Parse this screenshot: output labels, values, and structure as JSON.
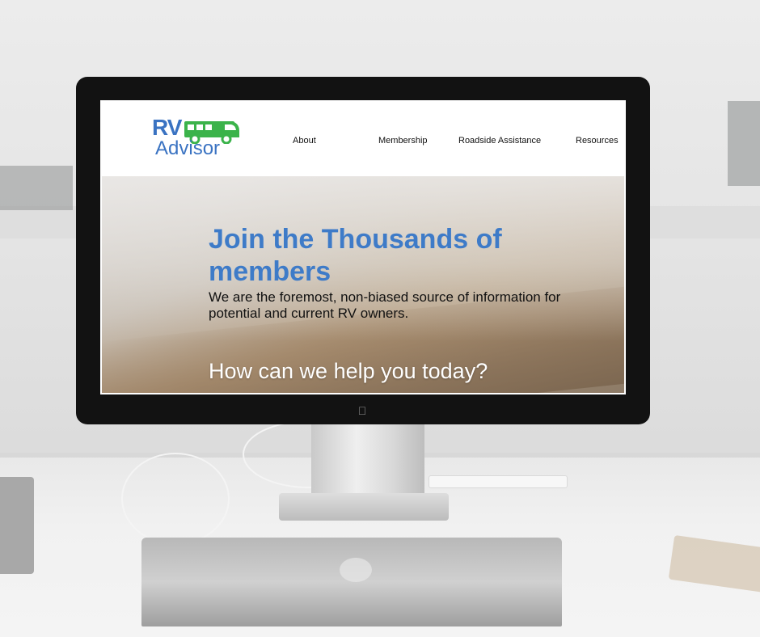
{
  "site": {
    "logo": {
      "line1": "RV",
      "line2": "Advisor",
      "brand_blue": "#3a73c2",
      "brand_green": "#3bb34a"
    },
    "nav": [
      {
        "label": "About"
      },
      {
        "label": "Membership"
      },
      {
        "label": "Roadside Assistance"
      },
      {
        "label": "Resources"
      }
    ],
    "hero": {
      "title": "Join the Thousands of members",
      "subtitle": "We are the foremost, non-biased source of information for potential and current RV owners.",
      "help_text": "How can we help you today?",
      "title_color": "#3e7bc8"
    }
  }
}
